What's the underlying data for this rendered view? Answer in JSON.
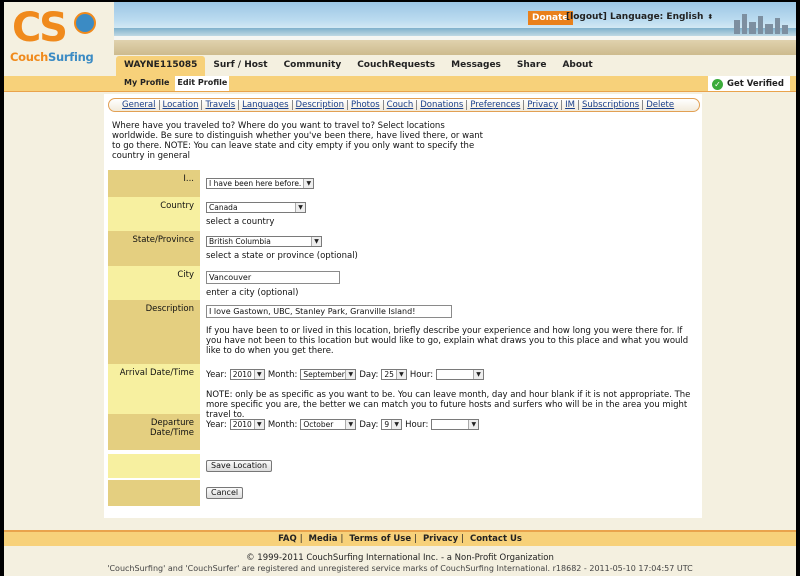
{
  "header": {
    "logo_letters": "CS",
    "logo_name_a": "Couch",
    "logo_name_b": "Surfing",
    "donate": "Donate",
    "logout": "[logout]",
    "language_label": "Language:",
    "language_value": "English"
  },
  "nav": {
    "items": [
      {
        "label": "WAYNE115085",
        "active": true
      },
      {
        "label": "Surf / Host"
      },
      {
        "label": "Community"
      },
      {
        "label": "CouchRequests"
      },
      {
        "label": "Messages"
      },
      {
        "label": "Share"
      },
      {
        "label": "About"
      }
    ],
    "sub": [
      {
        "label": "My Profile"
      },
      {
        "label": "Edit Profile",
        "active": true
      }
    ],
    "verified": "Get Verified"
  },
  "tabs": [
    "General",
    "Location",
    "Travels",
    "Languages",
    "Description",
    "Photos",
    "Couch",
    "Donations",
    "Preferences",
    "Privacy",
    "IM",
    "Subscriptions",
    "Delete"
  ],
  "intro": "Where have you traveled to? Where do you want to travel to? Select locations worldwide. Be sure to distinguish whether you've been there, have lived there, or want to go there. NOTE: You can leave state and city empty if you only want to specify the country in general",
  "form": {
    "i_label": "I...",
    "i_value": "I have been here before.",
    "country_label": "Country",
    "country_value": "Canada",
    "country_hint": "select a country",
    "state_label": "State/Province",
    "state_value": "British Columbia",
    "state_hint": "select a state or province (optional)",
    "city_label": "City",
    "city_value": "Vancouver",
    "city_hint": "enter a city (optional)",
    "desc_label": "Description",
    "desc_value": "I love Gastown, UBC, Stanley Park, Granville Island!",
    "desc_hint": "If you have been to or lived in this location, briefly describe your experience and how long you were there for. If you have not been to this location but would like to go, explain what draws you to this place and what you would like to do when you get there.",
    "arrival_label": "Arrival Date/Time",
    "arrival": {
      "year": "2010",
      "month": "September",
      "day": "25",
      "hour": ""
    },
    "arrival_note": "NOTE: only be as specific as you want to be. You can leave month, day and hour blank if it is not appropriate. The more specific you are, the better we can match you to future hosts and surfers who will be in the area you might travel to.",
    "departure_label": "Departure Date/Time",
    "departure": {
      "year": "2010",
      "month": "October",
      "day": "9",
      "hour": ""
    },
    "year_label": "Year:",
    "month_label": "Month:",
    "day_label": "Day:",
    "hour_label": "Hour:",
    "save": "Save Location",
    "cancel": "Cancel"
  },
  "footer": {
    "links": [
      "FAQ",
      "Media",
      "Terms of Use",
      "Privacy",
      "Contact Us"
    ],
    "copyright": "© 1999-2011 CouchSurfing International Inc. - a Non-Profit Organization",
    "trademark": "'CouchSurfing' and 'CouchSurfer' are registered and unregistered service marks of CouchSurfing International. r18682 - 2011-05-10 17:04:57 UTC"
  }
}
